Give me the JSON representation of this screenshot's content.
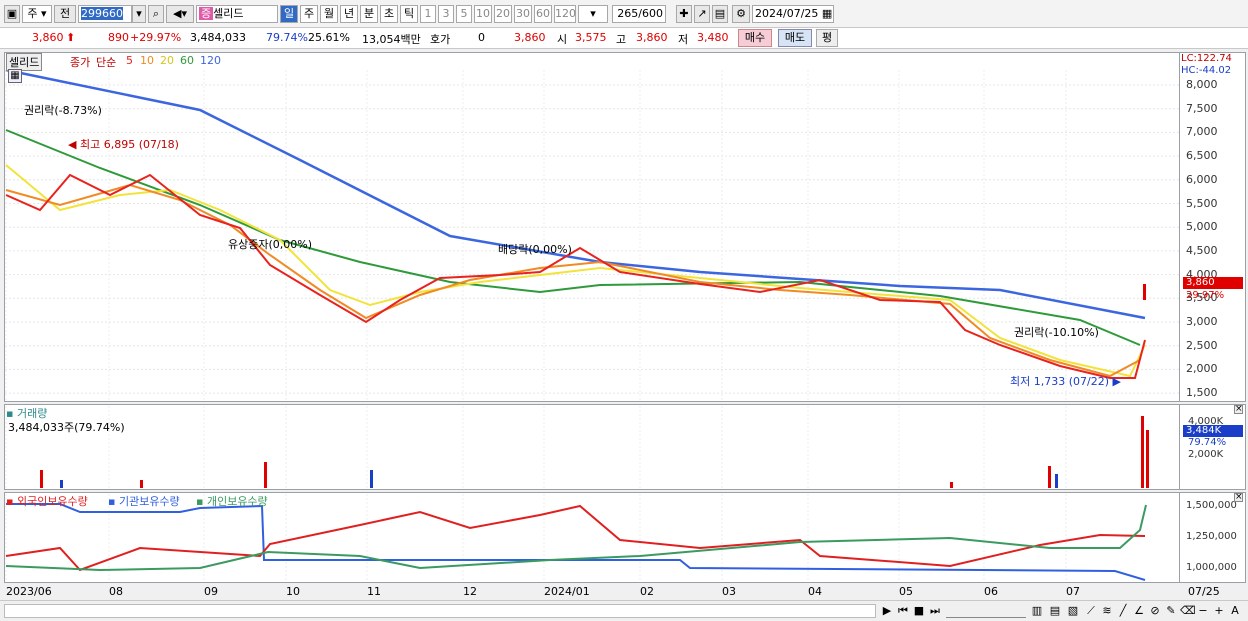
{
  "toolbar": {
    "market": "주",
    "prev": "전",
    "code": "299660",
    "name": "셀리드",
    "periods": [
      "일",
      "주",
      "월",
      "년",
      "분",
      "초",
      "틱"
    ],
    "minutes": [
      "1",
      "3",
      "5",
      "10",
      "20",
      "30",
      "60",
      "120"
    ],
    "count": "265",
    "count_total": "/600",
    "date": "2024/07/25"
  },
  "quote": {
    "price": "3,860",
    "change": "890",
    "change_pct": "+29.97%",
    "volume": "3,484,033",
    "vol_ratio": "79.74%",
    "turnover": "25.61%",
    "amount": "13,054백만",
    "hoga_label": "호가",
    "hoga_value": "0",
    "cur": "3,860",
    "open_label": "시",
    "open": "3,575",
    "high_label": "고",
    "high": "3,860",
    "low_label": "저",
    "low": "3,480",
    "buy": "매수",
    "sell": "매도",
    "avg": "평"
  },
  "price_panel": {
    "title": "셀리드",
    "legend": {
      "close": "종가",
      "simple": "단순",
      "ma5": "5",
      "ma10": "10",
      "ma20": "20",
      "ma60": "60",
      "ma120": "120"
    },
    "annotations": {
      "rights1": "권리락(-8.73%)",
      "high": "최고 6,895 (07/18)",
      "capinc": "유상증자(0,00%)",
      "dividend": "배당락(0,00%)",
      "rights2": "권리락(-10.10%)",
      "low": "최저 1,733 (07/22)"
    },
    "lc": "LC:122.74",
    "hc": "HC:-44.02",
    "y_ticks": [
      "8,000",
      "7,500",
      "7,000",
      "6,500",
      "6,000",
      "5,500",
      "5,000",
      "4,500",
      "4,000",
      "3,500",
      "3,000",
      "2,500",
      "2,000",
      "1,500"
    ],
    "price_tag": "3,860",
    "pct_tag": "29.97%"
  },
  "volume_panel": {
    "title": "거래량",
    "value": "3,484,033주(79.74%)",
    "y_ticks": [
      "4,000K",
      "2,000K"
    ],
    "tag": "3,484K",
    "tag_pct": "79.74%"
  },
  "holding_panel": {
    "foreign": "외국인보유수량",
    "inst": "기관보유수량",
    "indiv": "개인보유수량",
    "y_ticks": [
      "1,500,000",
      "1,250,000",
      "1,000,000"
    ]
  },
  "x_labels": [
    "2023/06",
    "08",
    "09",
    "10",
    "11",
    "12",
    "2024/01",
    "02",
    "03",
    "04",
    "05",
    "06",
    "07"
  ],
  "x_right": "07/25",
  "colors": {
    "up": "#e00000",
    "down": "#1a3ec8",
    "ma5": "#e8231e",
    "ma10": "#f08a24",
    "ma20": "#f2e33a",
    "ma60": "#2e9a3a",
    "ma120": "#3b66e0",
    "foreign": "#e02020",
    "inst": "#3060e0",
    "indiv": "#3a9a60"
  }
}
